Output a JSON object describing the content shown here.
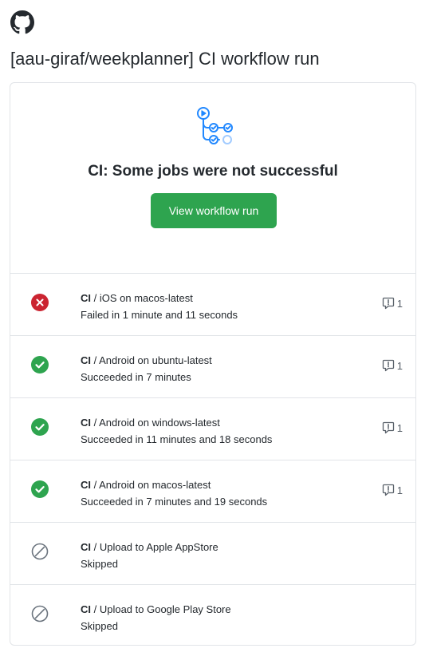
{
  "email": {
    "subject": "[aau-giraf/weekplanner] CI workflow run"
  },
  "summary": {
    "headline": "CI: Some jobs were not successful",
    "button_label": "View workflow run"
  },
  "colors": {
    "success": "#2ea44f",
    "failure": "#cb2431",
    "skipped": "#6a737d",
    "accent": "#2188ff"
  },
  "jobs": [
    {
      "workflow": "CI",
      "separator": " / ",
      "name": "iOS on macos-latest",
      "status_text": "Failed in 1 minute and 11 seconds",
      "status": "failure",
      "status_icon": "x-circle-fill-icon",
      "annotations": "1"
    },
    {
      "workflow": "CI",
      "separator": " / ",
      "name": "Android on ubuntu-latest",
      "status_text": "Succeeded in 7 minutes",
      "status": "success",
      "status_icon": "check-circle-fill-icon",
      "annotations": "1"
    },
    {
      "workflow": "CI",
      "separator": " / ",
      "name": "Android on windows-latest",
      "status_text": "Succeeded in 11 minutes and 18 seconds",
      "status": "success",
      "status_icon": "check-circle-fill-icon",
      "annotations": "1"
    },
    {
      "workflow": "CI",
      "separator": " / ",
      "name": "Android on macos-latest",
      "status_text": "Succeeded in 7 minutes and 19 seconds",
      "status": "success",
      "status_icon": "check-circle-fill-icon",
      "annotations": "1"
    },
    {
      "workflow": "CI",
      "separator": " / ",
      "name": "Upload to Apple AppStore",
      "status_text": "Skipped",
      "status": "skipped",
      "status_icon": "skip-icon",
      "annotations": null
    },
    {
      "workflow": "CI",
      "separator": " / ",
      "name": "Upload to Google Play Store",
      "status_text": "Skipped",
      "status": "skipped",
      "status_icon": "skip-icon",
      "annotations": null
    }
  ]
}
